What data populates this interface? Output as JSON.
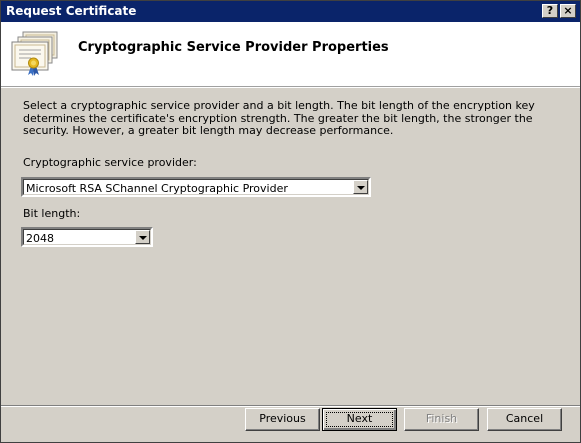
{
  "window": {
    "title": "Request Certificate",
    "help_label": "?",
    "close_label": "×"
  },
  "header": {
    "title": "Cryptographic Service Provider Properties",
    "icon": "certificate-icon"
  },
  "description": "Select a cryptographic service provider and a bit length. The bit length of the encryption key determines the certificate's encryption strength. The greater the bit length, the stronger the security. However, a greater bit length may decrease performance.",
  "csp": {
    "label": "Cryptographic service provider:",
    "value": "Microsoft RSA SChannel Cryptographic Provider"
  },
  "bit_length": {
    "label": "Bit length:",
    "value": "2048"
  },
  "buttons": {
    "previous": "Previous",
    "next": "Next",
    "finish": "Finish",
    "cancel": "Cancel"
  },
  "colors": {
    "titlebar": "#0a246a",
    "face": "#d4d0c8"
  }
}
